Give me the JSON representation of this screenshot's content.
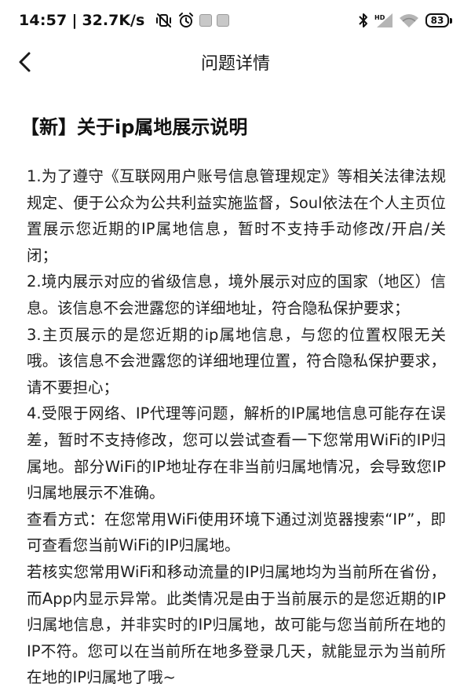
{
  "status_bar": {
    "time": "14:57",
    "separator": "|",
    "net_speed": "32.7K/s",
    "hd_label": "HD",
    "battery_level": "83",
    "icons": [
      "vibrate-off-icon",
      "alarm-icon",
      "app-notification-icon",
      "app-notification-icon",
      "bluetooth-icon",
      "signal-hd-icon",
      "wifi-icon",
      "battery-icon"
    ]
  },
  "nav": {
    "title": "问题详情",
    "back_icon": "chevron-left-icon"
  },
  "article": {
    "title": "【新】关于ip属地展示说明",
    "paragraphs": [
      "1.为了遵守《互联网用户账号信息管理规定》等相关法律法规规定、便于公众为公共利益实施监督，Soul依法在个人主页位置展示您近期的IP属地信息，暂时不支持手动修改/开启/关闭；",
      "2.境内展示对应的省级信息，境外展示对应的国家（地区）信息。该信息不会泄露您的详细地址，符合隐私保护要求；",
      "3.主页展示的是您近期的ip属地信息，与您的位置权限无关哦。该信息不会泄露您的详细地理位置，符合隐私保护要求，请不要担心；",
      "4.受限于网络、IP代理等问题，解析的IP属地信息可能存在误差，暂时不支持修改，您可以尝试查看一下您常用WiFi的IP归属地。部分WiFi的IP地址存在非当前归属地情况，会导致您IP归属地展示不准确。",
      "查看方式：在您常用WiFi使用环境下通过浏览器搜索“IP”，即可查看您当前WiFi的IP归属地。",
      "若核实您常用WiFi和移动流量的IP归属地均为当前所在省份，而App内显示异常。此类情况是由于当前展示的是您近期的IP归属地信息，并非实时的IP归属地，故可能与您当前所在地的IP不符。您可以在当前所在地多登录几天，就能显示为当前所在地的IP归属地了哦~"
    ]
  }
}
